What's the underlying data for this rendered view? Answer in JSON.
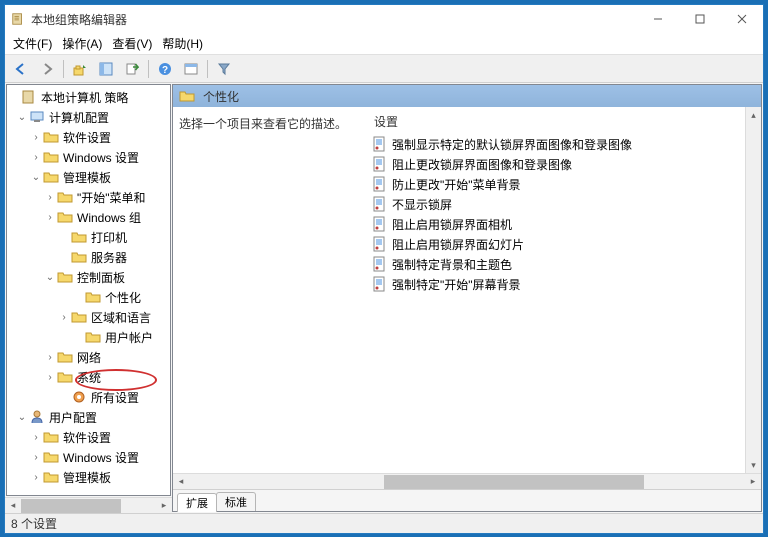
{
  "window": {
    "title": "本地组策略编辑器"
  },
  "menu": {
    "file": "文件(F)",
    "action": "操作(A)",
    "view": "查看(V)",
    "help": "帮助(H)"
  },
  "tree": {
    "root": "本地计算机 策略",
    "computer_config": "计算机配置",
    "software_settings": "软件设置",
    "windows_settings": "Windows 设置",
    "admin_templates": "管理模板",
    "start_menu": "\"开始\"菜单和",
    "windows_components": "Windows 组",
    "printers": "打印机",
    "servers": "服务器",
    "control_panel": "控制面板",
    "personalization": "个性化",
    "region_lang": "区域和语言",
    "user_accounts": "用户帐户",
    "network": "网络",
    "system": "系统",
    "all_settings": "所有设置",
    "user_config": "用户配置",
    "u_software": "软件设置",
    "u_windows": "Windows 设置",
    "u_admin": "管理模板"
  },
  "right": {
    "header": "个性化",
    "prompt": "选择一个项目来查看它的描述。",
    "col_setting": "设置",
    "settings": [
      "强制显示特定的默认锁屏界面图像和登录图像",
      "阻止更改锁屏界面图像和登录图像",
      "防止更改\"开始\"菜单背景",
      "不显示锁屏",
      "阻止启用锁屏界面相机",
      "阻止启用锁屏界面幻灯片",
      "强制特定背景和主题色",
      "强制特定\"开始\"屏幕背景"
    ],
    "tab_ext": "扩展",
    "tab_std": "标准"
  },
  "status": "8 个设置"
}
